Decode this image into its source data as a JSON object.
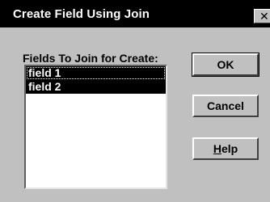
{
  "window": {
    "title": "Create Field Using Join",
    "close_glyph": "✕"
  },
  "list": {
    "label": "Fields To Join for Create:",
    "items": [
      {
        "label": "field 1",
        "selected": true
      },
      {
        "label": "field 2",
        "selected": true
      }
    ]
  },
  "buttons": {
    "ok": "OK",
    "cancel": "Cancel",
    "help_mnemonic": "H",
    "help_rest": "elp"
  },
  "colors": {
    "dialog_bg": "#c0c0c0",
    "titlebar_bg": "#000000",
    "selection_bg": "#000000",
    "selection_fg": "#ffffff"
  }
}
